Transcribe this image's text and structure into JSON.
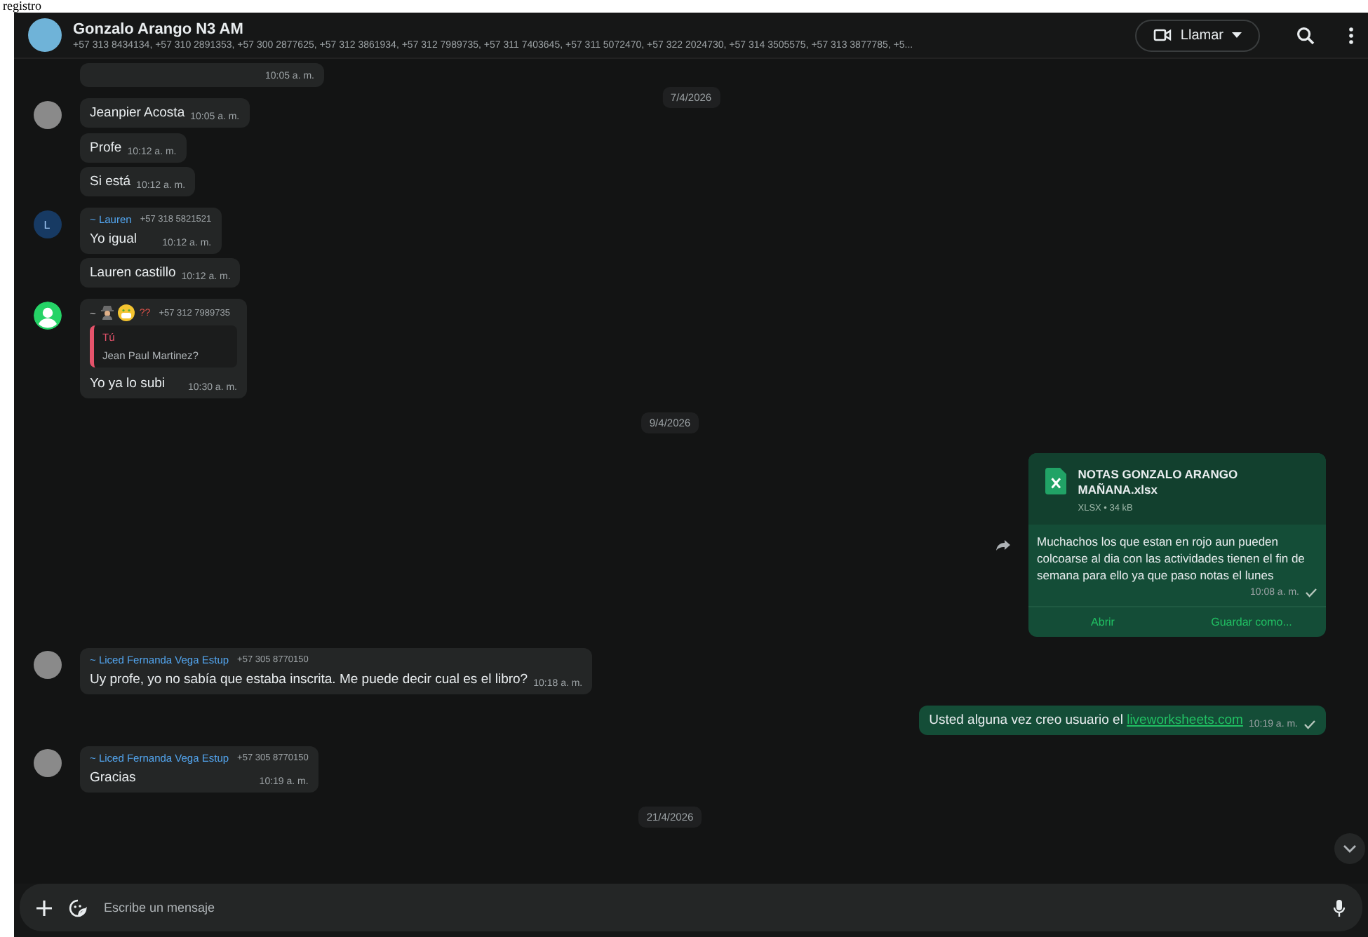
{
  "page_heading": "registro",
  "header": {
    "title": "Gonzalo Arango N3 AM",
    "members": "+57 313 8434134, +57 310 2891353, +57 300 2877625, +57 312 3861934, +57 312 7989735, +57 311 7403645, +57 311 5072470, +57 322 2024730, +57 314 3505575, +57 313 3877785, +5...",
    "call_label": "Llamar"
  },
  "sticky_date": "7/4/2026",
  "messages": [
    {
      "kind": "incoming",
      "time": "10:05 a. m."
    },
    {
      "kind": "incoming",
      "avatar": {
        "kind": "photo"
      },
      "text": "Jeanpier Acosta",
      "time": "10:05 a. m."
    },
    {
      "kind": "incoming",
      "text": "Profe",
      "time": "10:12 a. m."
    },
    {
      "kind": "incoming",
      "text": "Si está",
      "time": "10:12 a. m."
    },
    {
      "kind": "incoming",
      "avatar": {
        "kind": "letter",
        "letter": "L"
      },
      "sender": "~ Lauren",
      "color": "#53a6f0",
      "phone": "+57 318 5821521",
      "text": "Yo igual",
      "time": "10:12 a. m."
    },
    {
      "kind": "incoming",
      "text": "Lauren castillo",
      "time": "10:12 a. m."
    },
    {
      "kind": "incoming",
      "avatar": {
        "kind": "default"
      },
      "sender": "~",
      "sender_emoji": true,
      "sender_suffix": "??",
      "phone": "+57 312 7989735",
      "quote_author": "Tú",
      "quote_text": "Jean Paul Martinez?",
      "text": "Yo ya lo subi",
      "time": "10:30 a. m."
    },
    {
      "kind": "date",
      "text": "9/4/2026"
    },
    {
      "kind": "document",
      "file_name": "NOTAS GONZALO ARANGO MAÑANA.xlsx",
      "file_meta": "XLSX • 34 kB",
      "text": "Muchachos los que estan en rojo aun pueden colcoarse al dia con las actividades tienen el fin de semana para ello ya que paso notas el lunes",
      "time": "10:08 a. m.",
      "read": false,
      "actions": [
        "Abrir",
        "Guardar como..."
      ]
    },
    {
      "kind": "incoming",
      "avatar": {
        "kind": "photo"
      },
      "sender": "~ Liced Fernanda Vega Estup",
      "color": "#53a6f0",
      "phone": "+57 305 8770150",
      "text": "Uy profe, yo no sabía que estaba inscrita. Me puede decir cual es el libro?",
      "time": "10:18 a. m."
    },
    {
      "kind": "outgoing",
      "text": "Usted alguna vez creo usuario el",
      "link": "liveworksheets.com",
      "time": "10:19 a. m.",
      "read": false
    },
    {
      "kind": "incoming",
      "avatar": {
        "kind": "photo"
      },
      "sender": "~ Liced Fernanda Vega Estup",
      "color": "#53a6f0",
      "phone": "+57 305 8770150",
      "text": "Gracias",
      "time": "10:19 a. m."
    },
    {
      "kind": "date",
      "text": "21/4/2026"
    }
  ],
  "composer": {
    "placeholder": "Escribe un mensaje"
  }
}
